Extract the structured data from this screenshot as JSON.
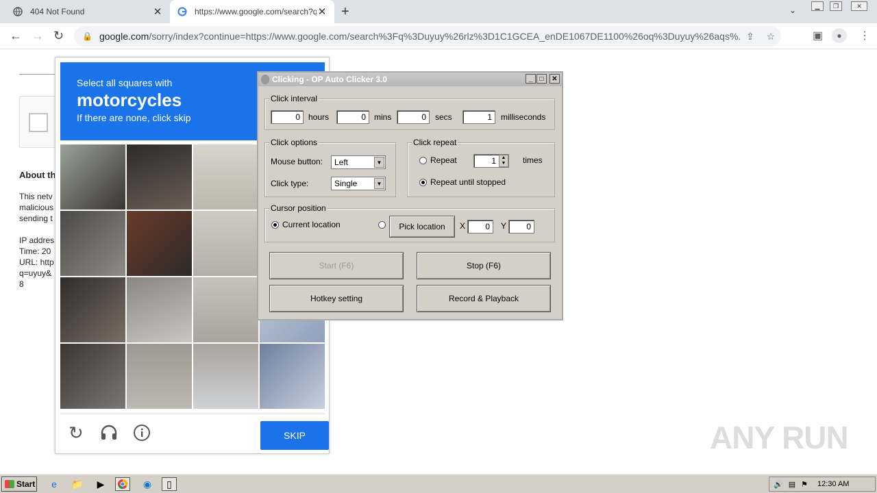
{
  "browser": {
    "tabs": [
      {
        "title": "404 Not Found",
        "icon": "globe-icon"
      },
      {
        "title": "https://www.google.com/search?q=",
        "icon": "google-g-icon"
      }
    ],
    "new_tab": "+",
    "url_host": "google.com",
    "url_rest": "/sorry/index?continue=https://www.google.com/search%3Fq%3Duyuy%26rlz%3D1C1GCEA_enDE1067DE1100%26oq%3Duyuy%26aqs%..."
  },
  "page": {
    "heading": "About th",
    "para": [
      "This netv",
      "malicious",
      "sending t"
    ],
    "info": [
      "IP addres",
      "Time: 20",
      "URL: http",
      "q=uyuy&",
      "8"
    ]
  },
  "captcha": {
    "line1": "Select all squares with",
    "keyword": "motorcycles",
    "line3": "If there are none, click skip",
    "skip": "SKIP"
  },
  "autoclicker": {
    "title": "Clicking - OP Auto Clicker 3.0",
    "interval": {
      "group": "Click interval",
      "hours": "0",
      "hours_l": "hours",
      "mins": "0",
      "mins_l": "mins",
      "secs": "0",
      "secs_l": "secs",
      "ms": "1",
      "ms_l": "milliseconds"
    },
    "options": {
      "group": "Click options",
      "button_l": "Mouse button:",
      "button": "Left",
      "type_l": "Click type:",
      "type": "Single"
    },
    "repeat": {
      "group": "Click repeat",
      "repeat_l": "Repeat",
      "count": "1",
      "times_l": "times",
      "until_l": "Repeat until stopped"
    },
    "cursor": {
      "group": "Cursor position",
      "current_l": "Current location",
      "pick": "Pick location",
      "x_l": "X",
      "x": "0",
      "y_l": "Y",
      "y": "0"
    },
    "buttons": {
      "start": "Start (F6)",
      "stop": "Stop (F6)",
      "hotkey": "Hotkey setting",
      "record": "Record & Playback"
    }
  },
  "watermark": "ANY RUN",
  "taskbar": {
    "start": "Start",
    "time": "12:30 AM"
  }
}
